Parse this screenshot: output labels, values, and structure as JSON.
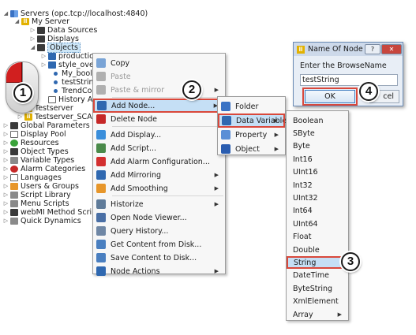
{
  "tree": {
    "rows": [
      {
        "label": "Servers (opc.tcp://localhost:4840)",
        "icon": "server-icon",
        "expander": "◢"
      },
      {
        "label": "My Server",
        "icon": "server-node-icon",
        "expander": "◢"
      },
      {
        "label": "Data Sources",
        "icon": "folder-icon",
        "expander": "▷"
      },
      {
        "label": "Displays",
        "icon": "folder-icon",
        "expander": "▷"
      },
      {
        "label": "Objects",
        "icon": "folder-icon",
        "expander": "◢"
      },
      {
        "label": "production",
        "icon": "folder-icon",
        "expander": "▷"
      },
      {
        "label": "style_overview",
        "icon": "folder-icon",
        "expander": "▷"
      },
      {
        "label": "My_bool_var",
        "icon": "variable-dot-icon",
        "expander": ""
      },
      {
        "label": "testString",
        "icon": "variable-dot-icon",
        "expander": ""
      },
      {
        "label": "TrendConfig",
        "icon": "variable-dot-icon",
        "expander": ""
      },
      {
        "label": "History Archives",
        "icon": "archive-icon",
        "expander": ""
      },
      {
        "label": "Testserver",
        "icon": "server-node-icon",
        "expander": "▷"
      },
      {
        "label": "Testserver_SCADA",
        "icon": "server-node-icon",
        "expander": "▷"
      },
      {
        "label": "Global Parameters",
        "icon": "parameters-icon",
        "expander": "▷"
      },
      {
        "label": "Display Pool",
        "icon": "display-pool-icon",
        "expander": "▷"
      },
      {
        "label": "Resources",
        "icon": "resources-icon",
        "expander": "▷"
      },
      {
        "label": "Object Types",
        "icon": "object-types-icon",
        "expander": "▷"
      },
      {
        "label": "Variable Types",
        "icon": "variable-types-icon",
        "expander": "▷"
      },
      {
        "label": "Alarm Categories",
        "icon": "alarm-categories-icon",
        "expander": "▷"
      },
      {
        "label": "Languages",
        "icon": "languages-icon",
        "expander": "▷"
      },
      {
        "label": "Users & Groups",
        "icon": "users-icon",
        "expander": "▷"
      },
      {
        "label": "Script Library",
        "icon": "script-library-icon",
        "expander": "▷"
      },
      {
        "label": "Menu Scripts",
        "icon": "menu-scripts-icon",
        "expander": "▷"
      },
      {
        "label": "webMI Method Scripts",
        "icon": "webmi-icon",
        "expander": "▷"
      },
      {
        "label": "Quick Dynamics",
        "icon": "quick-dynamics-icon",
        "expander": "▷"
      }
    ]
  },
  "context_menu": {
    "items": [
      {
        "label": "Copy",
        "icon": "copy-icon",
        "disabled": false,
        "submenu": false
      },
      {
        "label": "Paste",
        "icon": "paste-icon",
        "disabled": true,
        "submenu": false
      },
      {
        "label": "Paste & mirror",
        "icon": "paste-mirror-icon",
        "disabled": true,
        "submenu": true
      },
      {
        "label": "Add Node...",
        "icon": "add-node-icon",
        "disabled": false,
        "submenu": true
      },
      {
        "label": "Delete Node",
        "icon": "delete-node-icon",
        "disabled": false,
        "submenu": false
      },
      {
        "label": "Add Display...",
        "icon": "add-display-icon",
        "disabled": false,
        "submenu": false
      },
      {
        "label": "Add Script...",
        "icon": "add-script-icon",
        "disabled": false,
        "submenu": false
      },
      {
        "label": "Add Alarm Configuration...",
        "icon": "add-alarm-icon",
        "disabled": false,
        "submenu": false
      },
      {
        "label": "Add Mirroring",
        "icon": "add-mirroring-icon",
        "disabled": false,
        "submenu": true
      },
      {
        "label": "Add Smoothing",
        "icon": "add-smoothing-icon",
        "disabled": false,
        "submenu": true
      },
      {
        "label": "Historize",
        "icon": "historize-icon",
        "disabled": false,
        "submenu": true
      },
      {
        "label": "Open Node Viewer...",
        "icon": "node-viewer-icon",
        "disabled": false,
        "submenu": false
      },
      {
        "label": "Query History...",
        "icon": "query-history-icon",
        "disabled": false,
        "submenu": false
      },
      {
        "label": "Get Content from Disk...",
        "icon": "get-content-icon",
        "disabled": false,
        "submenu": false
      },
      {
        "label": "Save Content to Disk...",
        "icon": "save-content-icon",
        "disabled": false,
        "submenu": false
      },
      {
        "label": "Node Actions",
        "icon": "node-actions-icon",
        "disabled": false,
        "submenu": true
      }
    ]
  },
  "add_node_menu": {
    "items": [
      {
        "label": "Folder",
        "icon": "folder-icon",
        "submenu": false
      },
      {
        "label": "Data Variable",
        "icon": "data-variable-icon",
        "submenu": true
      },
      {
        "label": "Property",
        "icon": "property-icon",
        "submenu": true
      },
      {
        "label": "Object",
        "icon": "object-icon",
        "submenu": true
      }
    ]
  },
  "datatype_menu": {
    "items": [
      "Boolean",
      "SByte",
      "Byte",
      "Int16",
      "UInt16",
      "Int32",
      "UInt32",
      "Int64",
      "UInt64",
      "Float",
      "Double",
      "String",
      "DateTime",
      "ByteString",
      "XmlElement",
      "Array"
    ],
    "selected": "String"
  },
  "dialog": {
    "title": "Name Of Node",
    "prompt": "Enter the BrowseName",
    "value": "testString",
    "ok_label": "OK",
    "cancel_label": "cel",
    "help_label": "?",
    "close_label": "✕"
  },
  "steps": [
    "1",
    "2",
    "3",
    "4"
  ],
  "colors": {
    "highlight": "#c5dff5",
    "step_outline": "#d9483b",
    "mouse_button": "#d11f1f"
  }
}
